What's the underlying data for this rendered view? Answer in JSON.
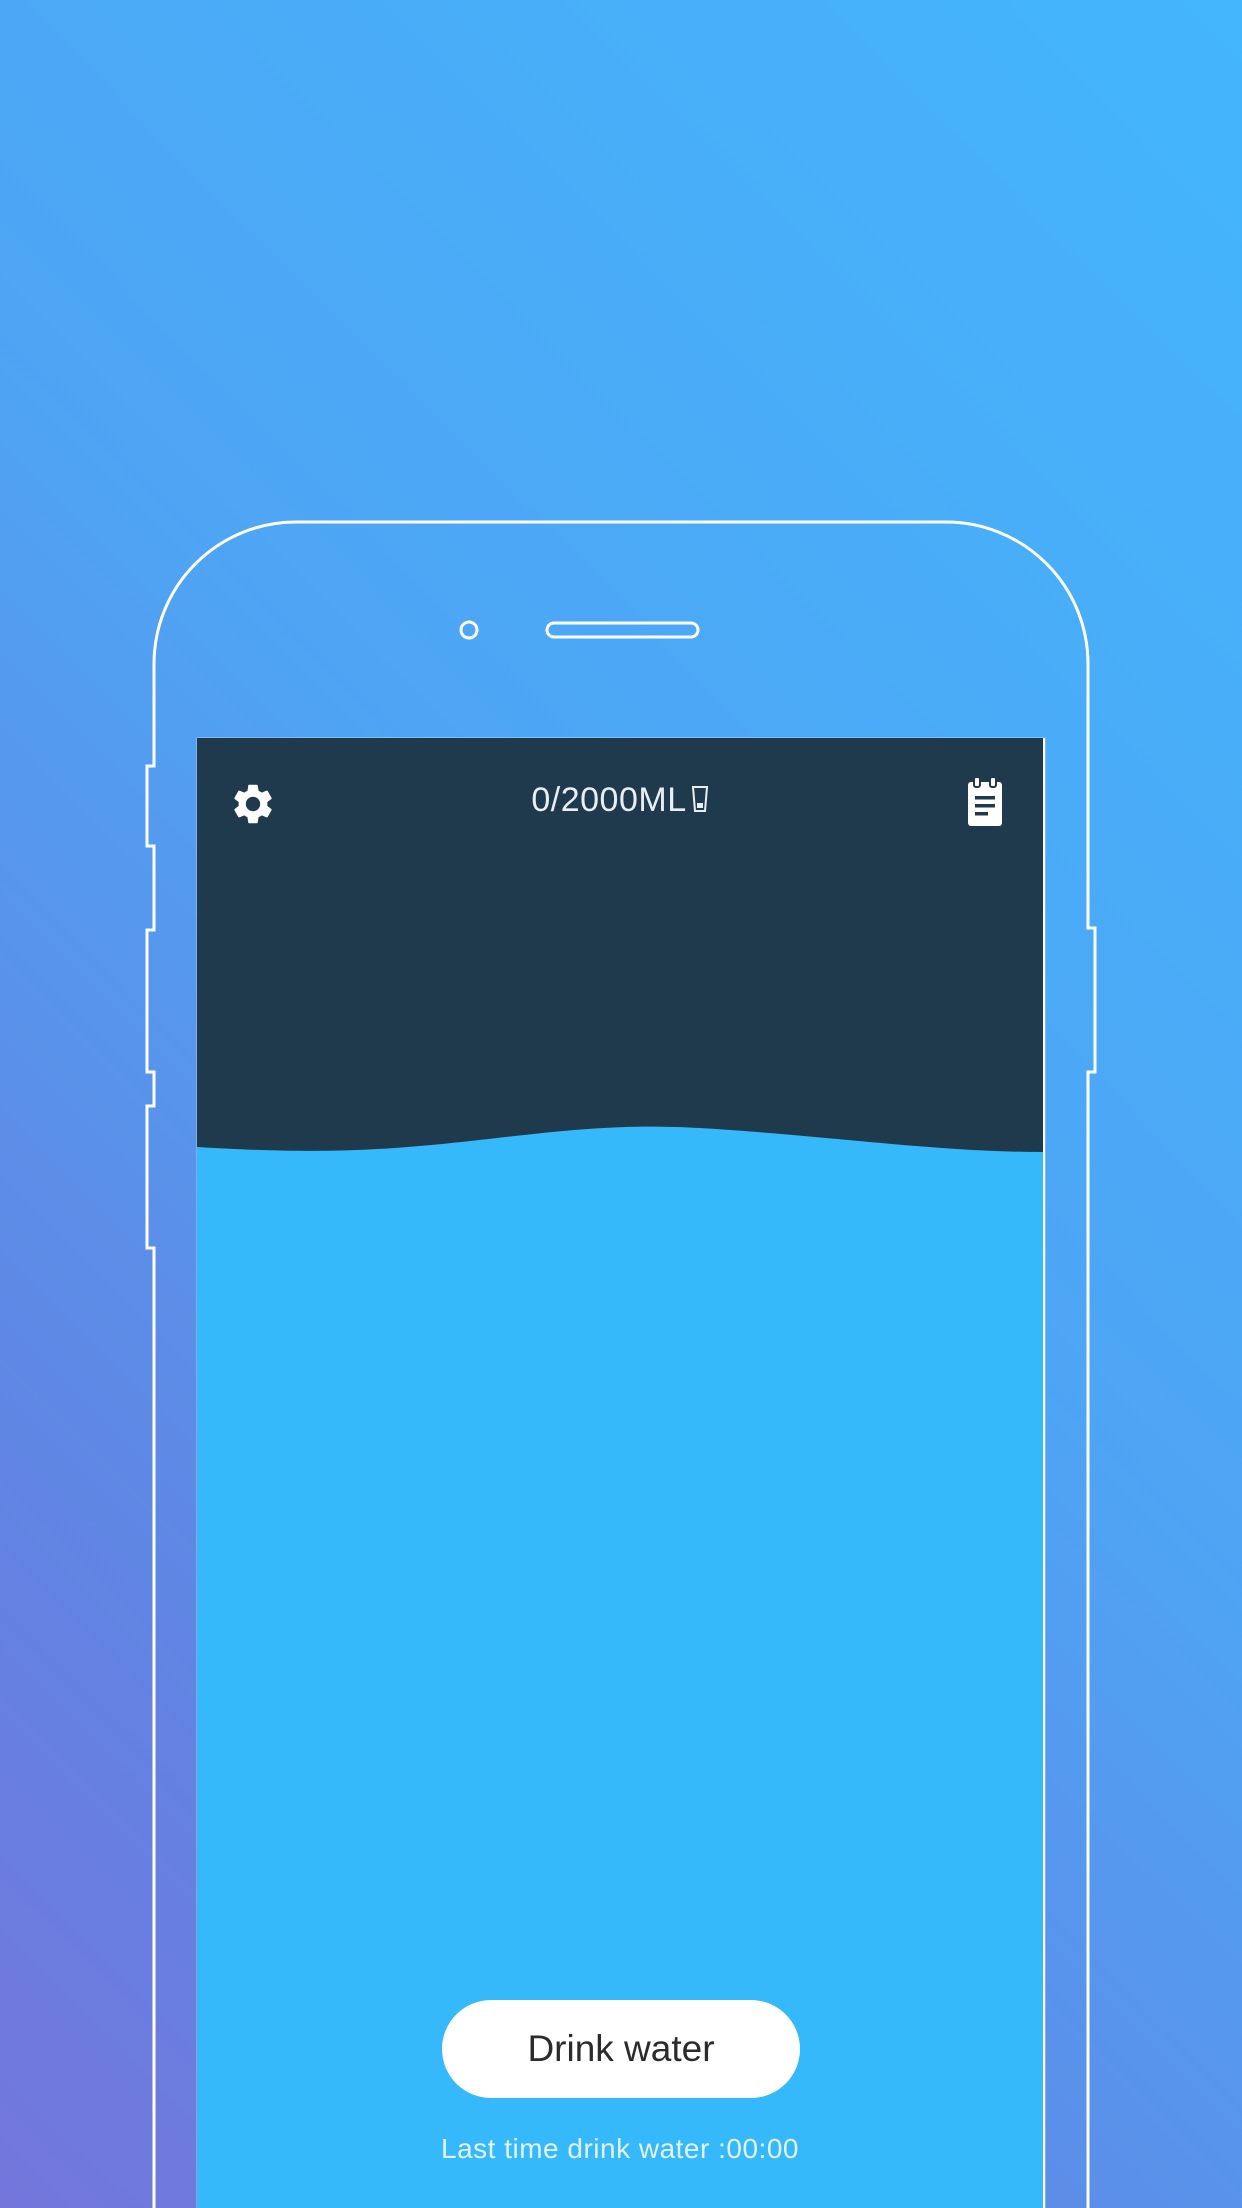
{
  "header": {
    "settings_icon": "gear-icon",
    "record_icon": "clipboard-icon",
    "intake_text": "0/2000ML",
    "intake_unit_icon": "cup-icon"
  },
  "progress": {
    "current_ml": 0,
    "goal_ml": 2000
  },
  "actions": {
    "drink_label": "Drink water"
  },
  "footer": {
    "last_time_text": "Last time drink water :00:00"
  },
  "colors": {
    "background_top_right": "#43b6fd",
    "background_bottom_left": "#7476dc",
    "screen_dark": "#1f3a4d",
    "water": "#35b9fb",
    "button": "#ffffff"
  }
}
